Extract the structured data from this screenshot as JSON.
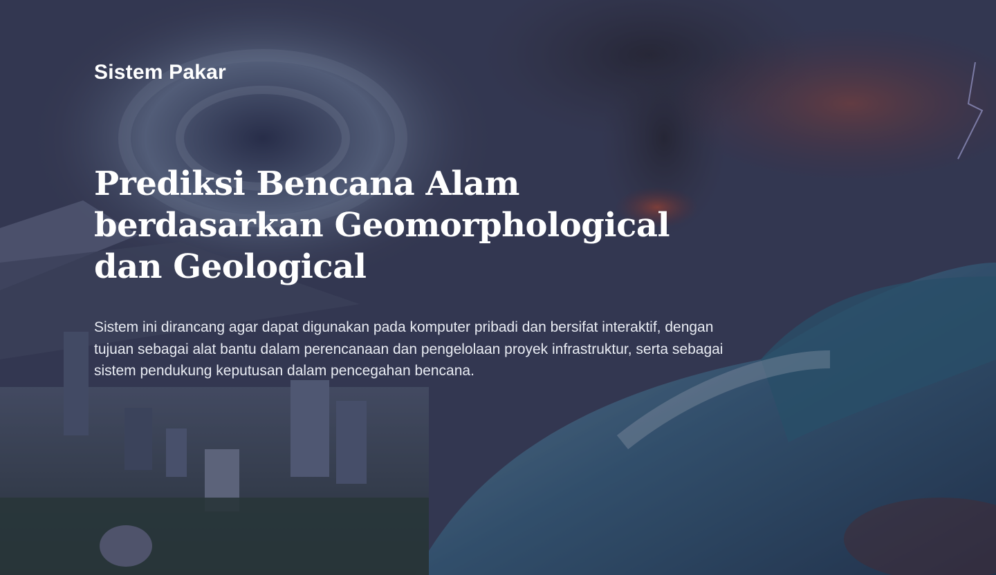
{
  "brand": {
    "title": "Sistem Pakar"
  },
  "hero": {
    "headline_lines": [
      "Prediksi Bencana Alam",
      "berdasarkan Geomorphological",
      "dan Geological"
    ],
    "description_lines": [
      "Sistem ini dirancang agar dapat digunakan pada komputer pribadi dan bersifat interaktif, dengan",
      "tujuan sebagai alat bantu dalam perencanaan dan pengelolaan proyek infrastruktur, serta sebagai",
      "sistem pendukung keputusan dalam pencegahan bencana."
    ]
  },
  "colors": {
    "text": "#ffffff",
    "overlay": "#1e203c",
    "ocean": "#3d6f8c",
    "lava": "#c4462a"
  }
}
